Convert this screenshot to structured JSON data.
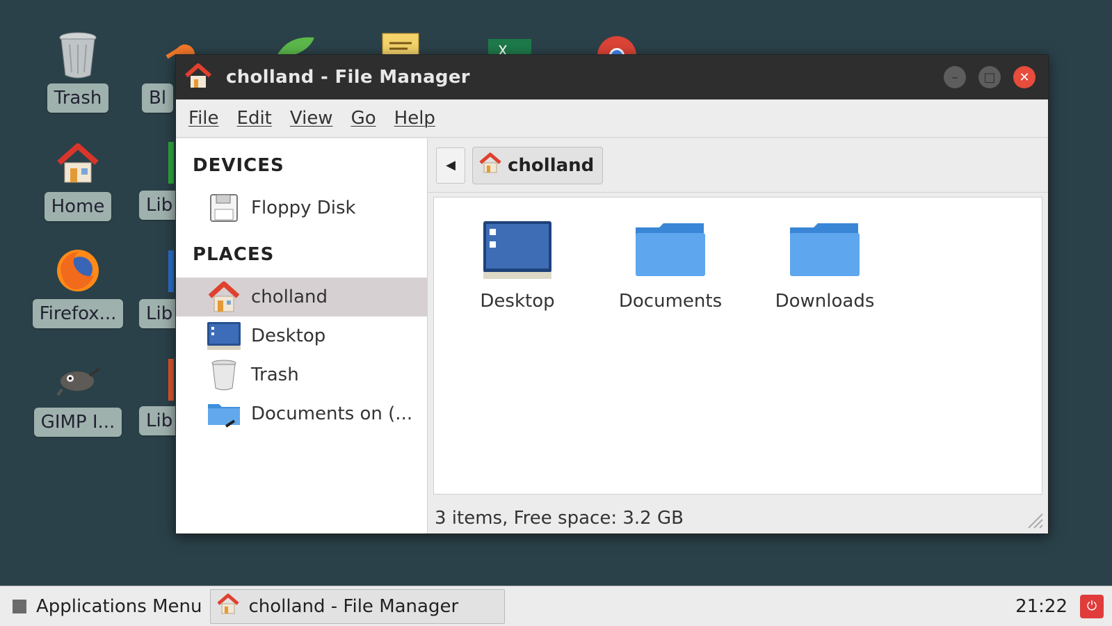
{
  "desktop": {
    "icons": [
      {
        "label": "Trash",
        "icon": "trash-icon"
      },
      {
        "label": "Home",
        "icon": "home-icon"
      },
      {
        "label": "Firefox...",
        "icon": "firefox-icon"
      },
      {
        "label": "GIMP I...",
        "icon": "gimp-icon"
      }
    ],
    "icons_col2": [
      {
        "label": "Bl"
      },
      {
        "label": "Lib"
      },
      {
        "label": "Lib"
      },
      {
        "label": "Lib"
      }
    ]
  },
  "window": {
    "title": "cholland - File Manager",
    "menu": [
      "File",
      "Edit",
      "View",
      "Go",
      "Help"
    ],
    "sidebar": {
      "devices_heading": "DEVICES",
      "devices": [
        {
          "label": "Floppy Disk",
          "icon": "floppy-disk-icon"
        }
      ],
      "places_heading": "PLACES",
      "places": [
        {
          "label": "cholland",
          "icon": "home-icon",
          "active": true
        },
        {
          "label": "Desktop",
          "icon": "desktop-icon"
        },
        {
          "label": "Trash",
          "icon": "trash-icon"
        },
        {
          "label": "Documents on (...",
          "icon": "network-folder-icon"
        }
      ]
    },
    "pathbar": {
      "current": "cholland"
    },
    "files": [
      {
        "name": "Desktop",
        "icon": "desktop-folder-icon"
      },
      {
        "name": "Documents",
        "icon": "folder-icon"
      },
      {
        "name": "Downloads",
        "icon": "folder-icon"
      }
    ],
    "status": "3 items, Free space: 3.2 GB"
  },
  "taskbar": {
    "app_menu": "Applications Menu",
    "task": "cholland - File Manager",
    "clock": "21:22"
  },
  "colors": {
    "desktop_bg": "#2b4149",
    "titlebar": "#2e2e2e",
    "close_button": "#e74c3c",
    "folder_blue": "#5aa2e6",
    "selection": "#d6d0d3"
  }
}
